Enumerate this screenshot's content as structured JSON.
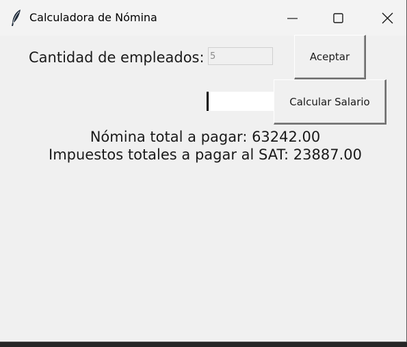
{
  "window": {
    "title": "Calculadora de Nómina",
    "icon": "feather-icon"
  },
  "controls": {
    "minimize_icon": "minimize-icon",
    "maximize_icon": "maximize-icon",
    "close_icon": "close-icon"
  },
  "form": {
    "employee_count_label": "Cantidad de empleados:",
    "employee_count_value": "5",
    "accept_button": "Aceptar",
    "salary_value": "",
    "calculate_button": "Calcular Salario"
  },
  "results": {
    "payroll_total": "Nómina total a pagar: 63242.00",
    "tax_total": "Impuestos totales a pagar al SAT: 23887.00"
  },
  "colors": {
    "window_bg": "#f0f0f0",
    "titlebar_bg": "#f3f3f3",
    "text": "#1a1a1a"
  }
}
